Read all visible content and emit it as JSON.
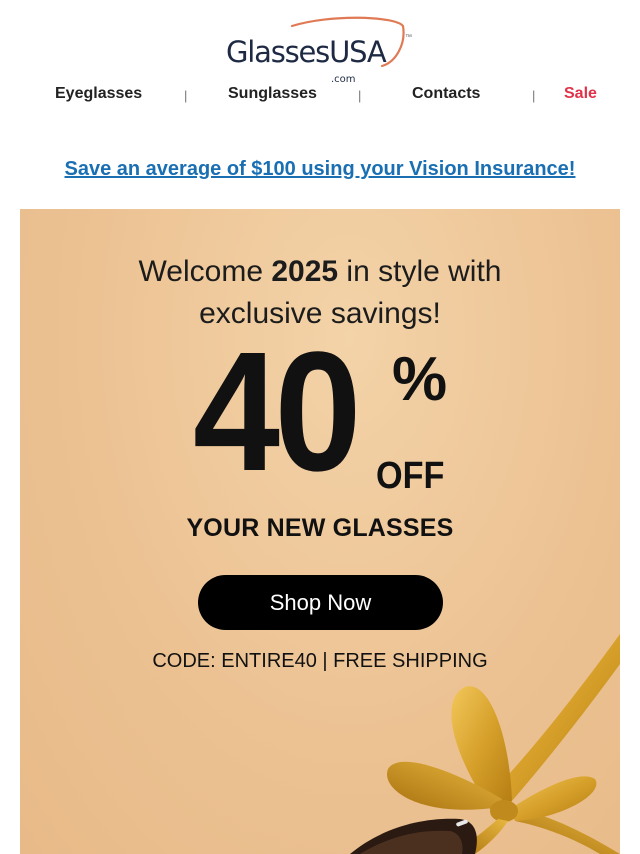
{
  "logo": {
    "main": "GlassesUSA",
    "sub": ".com",
    "tm": "™"
  },
  "nav": {
    "items": [
      "Eyeglasses",
      "Sunglasses",
      "Contacts",
      "Sale"
    ],
    "separator": "|"
  },
  "promo_link": "Save an average of $100 using your Vision Insurance!",
  "hero": {
    "welcome_pre": "Welcome ",
    "welcome_year": "2025",
    "welcome_post": " in style with",
    "welcome_line2": "exclusive savings!",
    "discount_number": "40",
    "discount_percent": "%",
    "discount_off": "OFF",
    "subtitle": "YOUR NEW GLASSES",
    "cta_label": "Shop Now",
    "code_line": "CODE: ENTIRE40 | FREE SHIPPING"
  },
  "colors": {
    "brand_navy": "#1e2a44",
    "logo_arc": "#e07a55",
    "sale_red": "#e0334a",
    "link_blue": "#1a6fb3",
    "hero_bg": "#ecc293",
    "ribbon_gold": "#d9a62e",
    "button_bg": "#000000"
  },
  "icons": [
    "logo-swoosh-icon",
    "gift-ribbon-graphic",
    "glasses-frame-graphic"
  ]
}
